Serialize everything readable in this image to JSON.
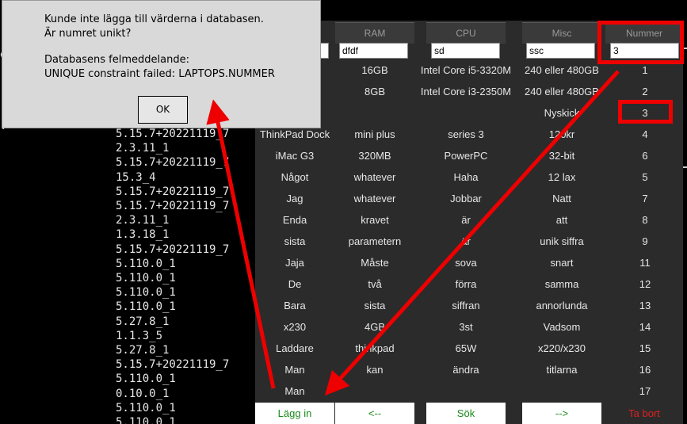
{
  "terminal": {
    "lines": [
      "5.15.7+20221119_7",
      "2.3.11_1",
      "5.15.7+20221119_7",
      "15.3_4",
      "5.15.7+20221119_7",
      "5.15.7+20221119_7",
      "2.3.11_1",
      "1.3.18_1",
      "5.15.7+20221119_7",
      "5.110.0_1",
      "5.110.0_1",
      "5.110.0_1",
      "5.110.0_1",
      "5.27.8_1",
      "1.1.3_5",
      "5.27.8_1",
      "5.15.7+20221119_7",
      "5.110.0_1",
      "0.10.0_1",
      "5.110.0_1",
      "5.110.0_1"
    ],
    "left_glyph": "e",
    "left_dot": "."
  },
  "dialog": {
    "line1": "Kunde inte lägga till värderna i databasen.",
    "line2": "Är numret unikt?",
    "line3": "Databasens felmeddelande:",
    "line4": "UNIQUE constraint failed: LAPTOPS.NUMMER",
    "ok_label": "OK"
  },
  "table": {
    "headers": [
      "RAM",
      "CPU",
      "Misc",
      "Nummer"
    ],
    "inputs": {
      "col0": "",
      "ram": "dfdf",
      "cpu": "sd",
      "misc": "ssc",
      "nummer": "3"
    },
    "rows": [
      [
        "",
        "16GB",
        "Intel Core i5-3320M",
        "240 eller 480GB",
        "1"
      ],
      [
        "",
        "8GB",
        "Intel Core i3-2350M",
        "240 eller 480GB",
        "2"
      ],
      [
        "",
        "",
        "",
        "Nyskick",
        "3"
      ],
      [
        "ThinkPad Dock",
        "mini plus",
        "series 3",
        "120kr",
        "4"
      ],
      [
        "iMac G3",
        "320MB",
        "PowerPC",
        "32-bit",
        "6"
      ],
      [
        "Något",
        "whatever",
        "Haha",
        "12 lax",
        "5"
      ],
      [
        "Jag",
        "whatever",
        "Jobbar",
        "Natt",
        "7"
      ],
      [
        "Enda",
        "kravet",
        "är",
        "att",
        "8"
      ],
      [
        "sista",
        "parametern",
        "är",
        "unik siffra",
        "9"
      ],
      [
        "Jaja",
        "Måste",
        "sova",
        "snart",
        "11"
      ],
      [
        "De",
        "två",
        "förra",
        "samma",
        "12"
      ],
      [
        "Bara",
        "sista",
        "siffran",
        "annorlunda",
        "13"
      ],
      [
        "x230",
        "4GB",
        "3st",
        "Vadsom",
        "14"
      ],
      [
        "Laddare",
        "thinkpad",
        "65W",
        "x220/x230",
        "15"
      ],
      [
        "Man",
        "kan",
        "ändra",
        "titlarna",
        "16"
      ],
      [
        "Man",
        "",
        "",
        "",
        "17"
      ]
    ],
    "buttons": {
      "add": "Lägg in",
      "prev": "<--",
      "search": "Sök",
      "next": "-->",
      "delete": "Ta bort"
    }
  },
  "colors": {
    "annotation_red": "#ee0000",
    "add_green": "#1b8a1b",
    "delete_red": "#e02020"
  }
}
